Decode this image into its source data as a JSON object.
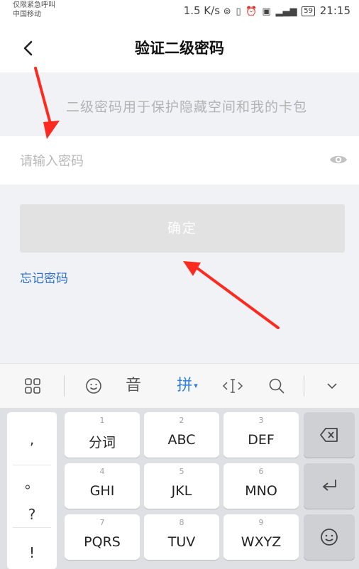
{
  "status_bar": {
    "carrier_line1": "仅限紧急呼叫",
    "carrier_line2": "中国移动",
    "speed": "1.5 K/s",
    "battery": "59",
    "time": "21:15"
  },
  "header": {
    "title": "验证二级密码"
  },
  "hint": "二级密码用于保护隐藏空间和我的卡包",
  "password": {
    "placeholder": "请输入密码",
    "value": ""
  },
  "confirm_label": "确定",
  "forgot_label": "忘记密码",
  "keyboard": {
    "toolbar": {
      "voice_label": "音",
      "pinyin_label": "拼"
    },
    "punctuation": [
      ",",
      "。",
      "?",
      "!"
    ],
    "keys": [
      {
        "num": "1",
        "label": "分词"
      },
      {
        "num": "2",
        "label": "ABC"
      },
      {
        "num": "3",
        "label": "DEF"
      },
      {
        "num": "4",
        "label": "GHI"
      },
      {
        "num": "5",
        "label": "JKL"
      },
      {
        "num": "6",
        "label": "MNO"
      },
      {
        "num": "7",
        "label": "PQRS"
      },
      {
        "num": "8",
        "label": "TUV"
      },
      {
        "num": "9",
        "label": "WXYZ"
      }
    ]
  },
  "colors": {
    "accent": "#2c7fe0",
    "link": "#2f72c9",
    "annotation_arrow": "#ff2a1f",
    "button_disabled": "#e2e2e2"
  }
}
